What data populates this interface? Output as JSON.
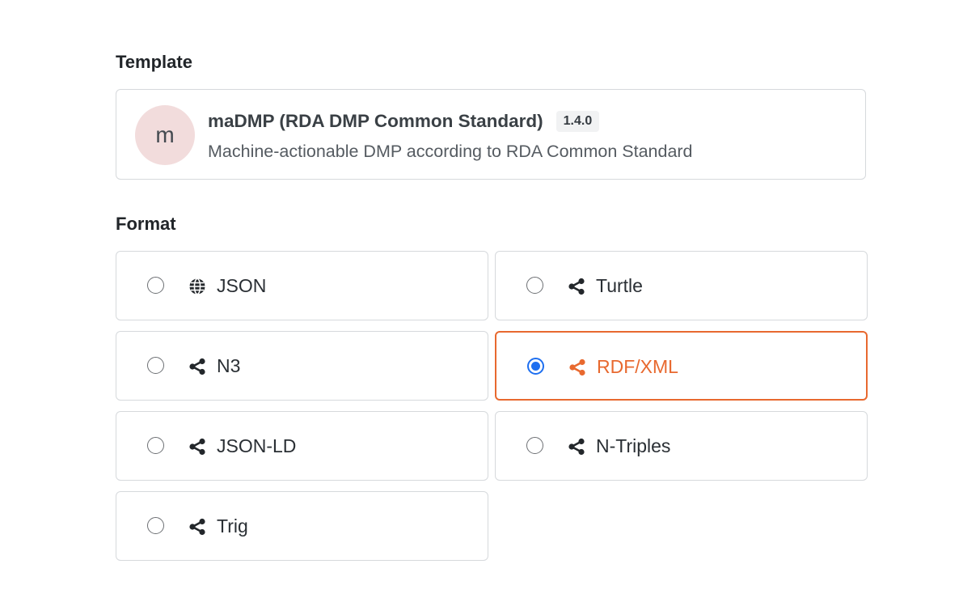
{
  "template": {
    "section_label": "Template",
    "avatar_letter": "m",
    "name": "maDMP (RDA DMP Common Standard)",
    "version": "1.4.0",
    "description": "Machine-actionable DMP according to RDA Common Standard"
  },
  "format": {
    "section_label": "Format",
    "selected": "RDF/XML",
    "accent_color": "#e8692f",
    "radio_color": "#1e6ff0",
    "options": [
      {
        "label": "JSON",
        "icon": "globe-icon",
        "selected": false
      },
      {
        "label": "Turtle",
        "icon": "share-icon",
        "selected": false
      },
      {
        "label": "N3",
        "icon": "share-icon",
        "selected": false
      },
      {
        "label": "RDF/XML",
        "icon": "share-icon",
        "selected": true
      },
      {
        "label": "JSON-LD",
        "icon": "share-icon",
        "selected": false
      },
      {
        "label": "N-Triples",
        "icon": "share-icon",
        "selected": false
      },
      {
        "label": "Trig",
        "icon": "share-icon",
        "selected": false
      }
    ]
  }
}
